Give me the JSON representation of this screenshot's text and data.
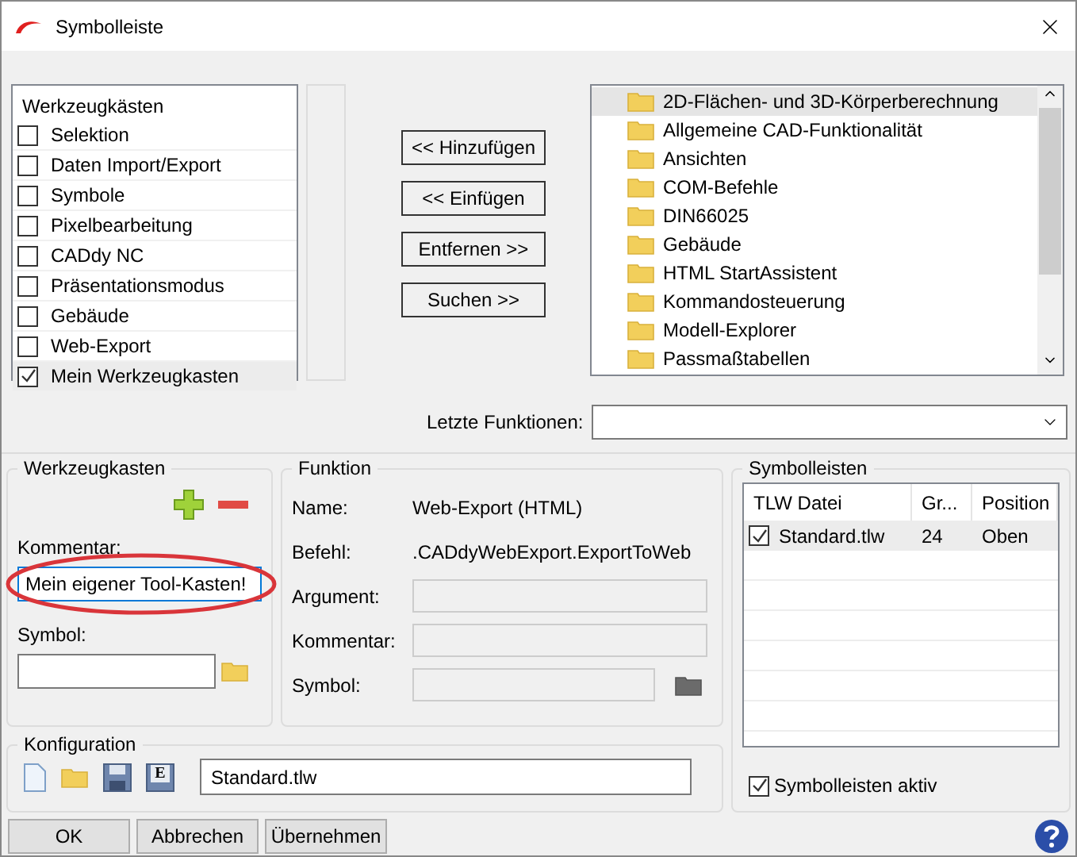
{
  "window": {
    "title": "Symbolleiste"
  },
  "toolboxes": {
    "heading": "Werkzeugkästen",
    "items": [
      {
        "label": "Selektion",
        "checked": false,
        "selected": false
      },
      {
        "label": "Daten Import/Export",
        "checked": false,
        "selected": false
      },
      {
        "label": "Symbole",
        "checked": false,
        "selected": false
      },
      {
        "label": "Pixelbearbeitung",
        "checked": false,
        "selected": false
      },
      {
        "label": "CADdy NC",
        "checked": false,
        "selected": false
      },
      {
        "label": "Präsentationsmodus",
        "checked": false,
        "selected": false
      },
      {
        "label": "Gebäude",
        "checked": false,
        "selected": false
      },
      {
        "label": "Web-Export",
        "checked": false,
        "selected": false
      },
      {
        "label": "Mein Werkzeugkasten",
        "checked": true,
        "selected": true
      }
    ]
  },
  "action_buttons": [
    "<< Hinzufügen",
    "<< Einfügen",
    "Entfernen >>",
    "Suchen >>"
  ],
  "function_tree": {
    "items": [
      {
        "label": "2D-Flächen- und 3D-Körperberechnung",
        "selected": true
      },
      {
        "label": "Allgemeine CAD-Funktionalität",
        "selected": false
      },
      {
        "label": "Ansichten",
        "selected": false
      },
      {
        "label": "COM-Befehle",
        "selected": false
      },
      {
        "label": "DIN66025",
        "selected": false
      },
      {
        "label": "Gebäude",
        "selected": false
      },
      {
        "label": "HTML StartAssistent",
        "selected": false
      },
      {
        "label": "Kommandosteuerung",
        "selected": false
      },
      {
        "label": "Modell-Explorer",
        "selected": false
      },
      {
        "label": "Passmaßtabellen",
        "selected": false
      }
    ]
  },
  "recent_functions": {
    "label": "Letzte Funktionen:"
  },
  "toolbox_group": {
    "title": "Werkzeugkasten",
    "comment_label": "Kommentar:",
    "comment_value": "Mein eigener Tool-Kasten!",
    "symbol_label": "Symbol:"
  },
  "function_group": {
    "title": "Funktion",
    "fields": [
      {
        "kind": "text",
        "label": "Name:",
        "value": "Web-Export (HTML)"
      },
      {
        "kind": "text",
        "label": "Befehl:",
        "value": ".CADdyWebExport.ExportToWeb"
      },
      {
        "kind": "input",
        "label": "Argument:"
      },
      {
        "kind": "input",
        "label": "Kommentar:"
      },
      {
        "kind": "symbol",
        "label": "Symbol:"
      }
    ]
  },
  "toolbars": {
    "title": "Symbolleisten",
    "columns": [
      "TLW Datei",
      "Gr...",
      "Position"
    ],
    "rows": [
      {
        "checked": true,
        "selected": true,
        "cells": [
          "Standard.tlw",
          "24",
          "Oben"
        ]
      }
    ],
    "active": {
      "label": "Symbolleisten aktiv",
      "checked": true
    }
  },
  "configuration": {
    "title": "Konfiguration",
    "save_as_letter": "E",
    "file": "Standard.tlw"
  },
  "footer_buttons": [
    "OK",
    "Abbrechen",
    "Übernehmen"
  ]
}
